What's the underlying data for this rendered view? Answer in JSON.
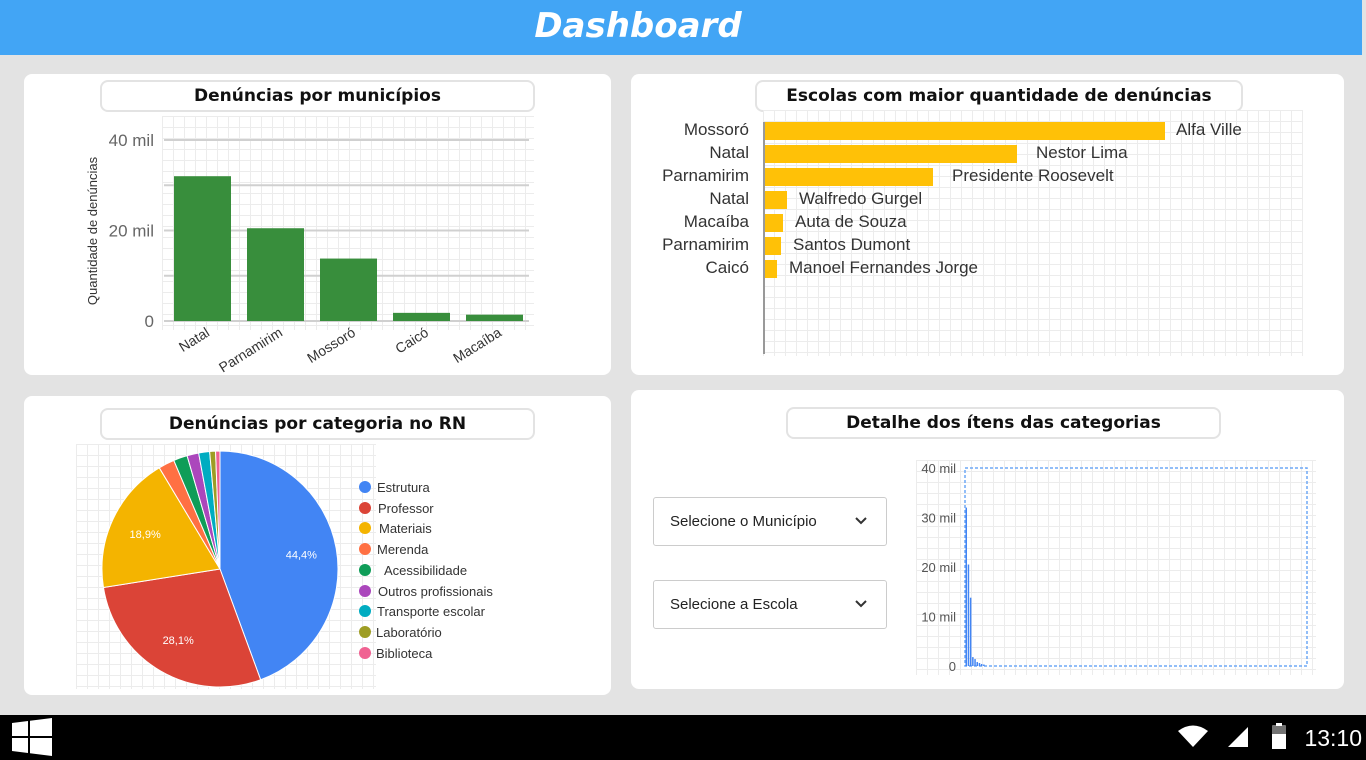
{
  "header": {
    "title": "Dashboard"
  },
  "municipios_card": {
    "title": "Denúncias por municípios",
    "chart_data": {
      "type": "bar",
      "title": "Denúncias por municípios",
      "ylabel": "Quantidade de denúncias",
      "categories": [
        "Natal",
        "Parnamirim",
        "Mossoró",
        "Caicó",
        "Macaíba"
      ],
      "values": [
        32000,
        20500,
        13800,
        1800,
        1400
      ],
      "ylim": [
        0,
        40000
      ],
      "yticks": [
        "0",
        "20 mil",
        "40 mil"
      ],
      "color": "#388e3c"
    }
  },
  "escolas_card": {
    "title": "Escolas com maior quantidade de denúncias",
    "chart_data": {
      "type": "bar",
      "orientation": "horizontal",
      "title": "Escolas com maior quantidade de denúncias",
      "categories": [
        "Mossoró",
        "Natal",
        "Parnamirim",
        "Natal",
        "Macaíba",
        "Parnamirim",
        "Caicó"
      ],
      "bar_labels": [
        "Alfa Ville",
        "Nestor Lima",
        "Presidente Roosevelt",
        "Walfredo Gurgel",
        "Auta de Souza",
        "Santos Dumont",
        "Manoel Fernandes Jorge"
      ],
      "values": [
        1000,
        630,
        420,
        55,
        45,
        40,
        30
      ],
      "color": "#ffc107"
    }
  },
  "categoria_card": {
    "title": "Denúncias por categoria no RN",
    "chart_data": {
      "type": "pie",
      "title": "Denúncias por categoria no RN",
      "series": [
        {
          "name": "Estrutura",
          "value": 44.4,
          "label": "44,4%",
          "color": "#4285f4"
        },
        {
          "name": "Professor",
          "value": 28.1,
          "label": "28,1%",
          "color": "#db4437"
        },
        {
          "name": "Materiais",
          "value": 18.9,
          "label": "18,9%",
          "color": "#f4b400"
        },
        {
          "name": "Merenda",
          "value": 2.2,
          "label": "",
          "color": "#ff7043"
        },
        {
          "name": "Acessibilidade",
          "value": 1.9,
          "label": "",
          "color": "#0f9d58"
        },
        {
          "name": "Outros profissionais",
          "value": 1.6,
          "label": "",
          "color": "#ab47bc"
        },
        {
          "name": "Transporte escolar",
          "value": 1.5,
          "label": "",
          "color": "#00acc1"
        },
        {
          "name": "Laboratório",
          "value": 0.8,
          "label": "",
          "color": "#9e9d24"
        },
        {
          "name": "Biblioteca",
          "value": 0.6,
          "label": "",
          "color": "#f06292"
        }
      ],
      "legend": "right"
    }
  },
  "detalhe_card": {
    "title": "Detalhe dos ítens das categorias",
    "select_municipio": "Selecione o Município",
    "select_escola": "Selecione a Escola",
    "chart_data": {
      "type": "bar",
      "yticks": [
        "0",
        "10 mil",
        "20 mil",
        "30 mil",
        "40 mil"
      ],
      "ylim": [
        0,
        40000
      ],
      "values": [
        32000,
        20500,
        13800,
        1800,
        1400,
        800,
        600,
        400,
        300
      ],
      "color": "#4285f4"
    }
  },
  "taskbar": {
    "start_icon": "windows-logo-icon",
    "wifi_icon": "wifi-icon",
    "signal_icon": "cell-signal-icon",
    "battery_icon": "battery-icon",
    "clock": "13:10"
  }
}
